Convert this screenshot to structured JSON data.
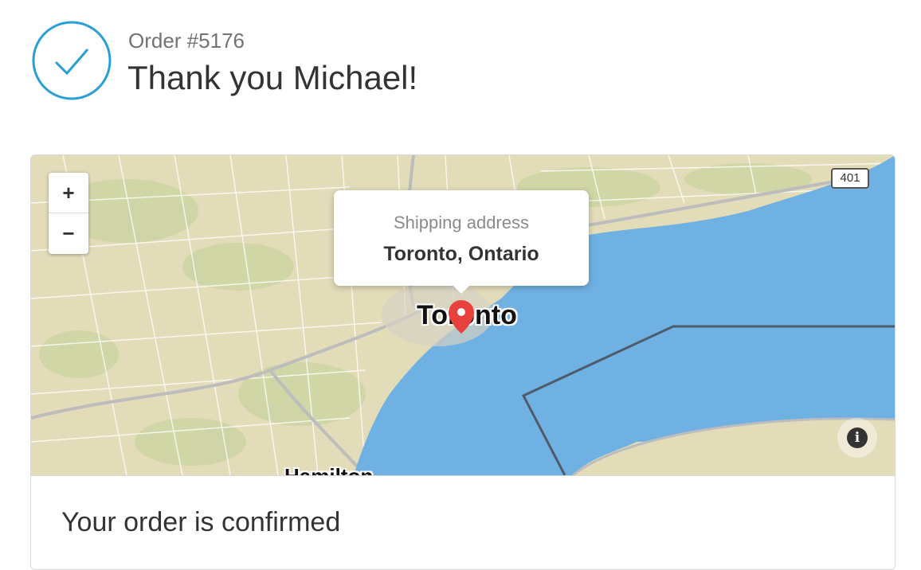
{
  "header": {
    "order_number": "Order #5176",
    "title": "Thank you Michael!",
    "status_icon": "checkmark-circle-icon",
    "accent_color": "#2a9fd6"
  },
  "map": {
    "zoom_in_label": "+",
    "zoom_out_label": "−",
    "popup": {
      "label": "Shipping address",
      "value": "Toronto, Ontario"
    },
    "city_label": "Toronto",
    "secondary_label": "Hamilton",
    "highway_label": "401",
    "info_label": "i",
    "marker_icon": "map-pin-icon",
    "marker_color": "#e8403c",
    "water_color": "#6fb1e2",
    "land_color": "#e3dcb9"
  },
  "confirmation": {
    "heading": "Your order is confirmed"
  }
}
